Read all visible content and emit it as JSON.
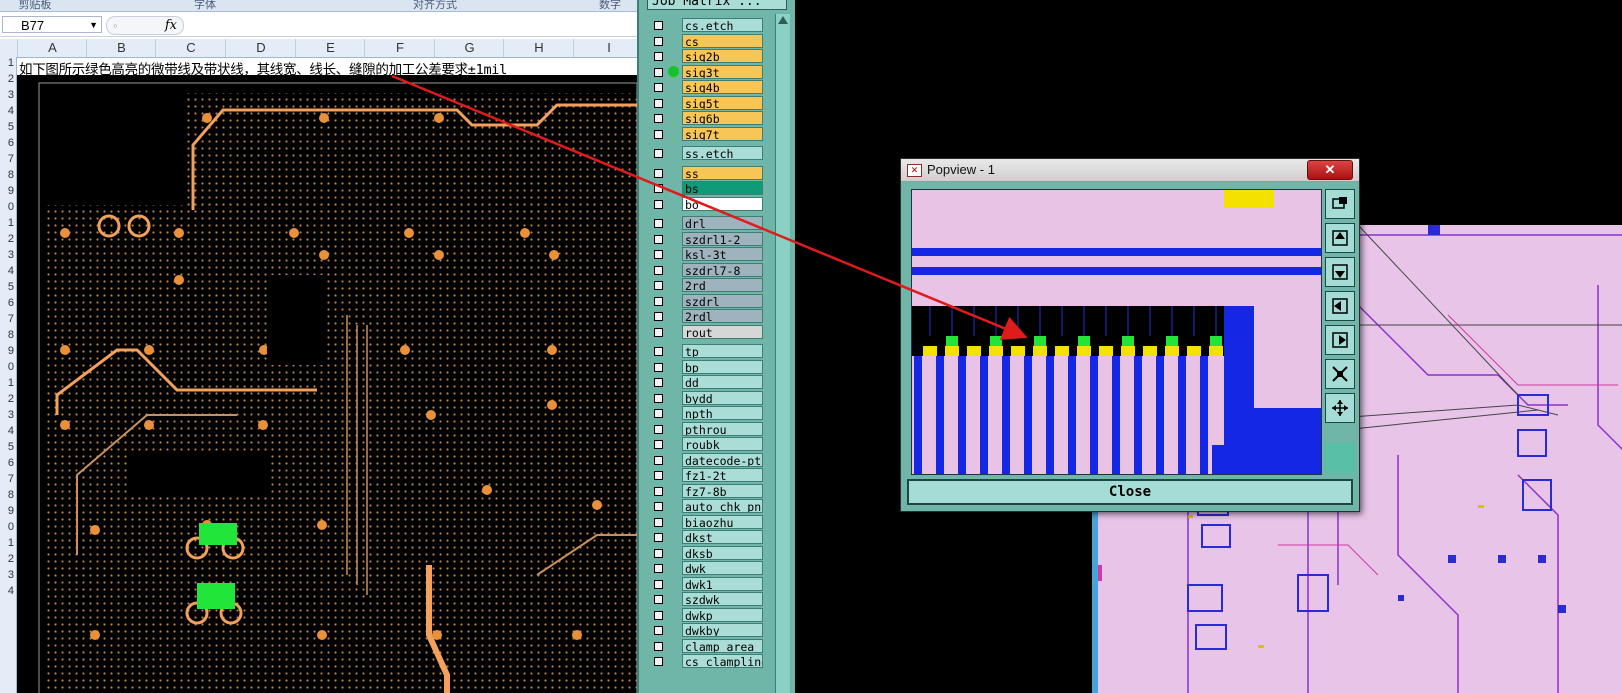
{
  "excel": {
    "ribbon_groups": [
      "剪贴板",
      "字体",
      "对齐方式",
      "数字"
    ],
    "name_box": "B77",
    "fx": "fx",
    "columns": [
      "A",
      "B",
      "C",
      "D",
      "E",
      "F",
      "G",
      "H",
      "I"
    ],
    "rows": [
      "1",
      "2",
      "3",
      "4",
      "5",
      "6",
      "7",
      "8",
      "9",
      "0",
      "1",
      "2",
      "3",
      "4",
      "5",
      "6",
      "7",
      "8",
      "9",
      "0",
      "1",
      "2",
      "3",
      "4",
      "5",
      "6",
      "7",
      "8",
      "9",
      "0",
      "1",
      "2",
      "3",
      "4"
    ],
    "cell_a1": "如下图所示绿色高亮的微带线及带状线，其线宽、线长、缝隙的加工公差要求±1mil"
  },
  "job_matrix": {
    "title": "Job Matrix ...",
    "layers": [
      {
        "name": "cs.etch",
        "color": "#a9ddd6"
      },
      {
        "name": "cs",
        "color": "#f7c656"
      },
      {
        "name": "sig2b",
        "color": "#f7c656"
      },
      {
        "name": "sig3t",
        "color": "#f7c656",
        "active": true
      },
      {
        "name": "sig4b",
        "color": "#f7c656"
      },
      {
        "name": "sig5t",
        "color": "#f7c656"
      },
      {
        "name": "sig6b",
        "color": "#f7c656"
      },
      {
        "name": "sig7t",
        "color": "#f7c656"
      },
      {
        "name": "ss.etch",
        "color": "#a9ddd6"
      },
      {
        "name": "ss",
        "color": "#f7c656"
      },
      {
        "name": "bs",
        "color": "#0f9a78"
      },
      {
        "name": "bo",
        "color": "#ffffff"
      },
      {
        "name": "drl",
        "color": "#9eb3bd"
      },
      {
        "name": "szdrl1-2",
        "color": "#9eb3bd"
      },
      {
        "name": "ksl-3t",
        "color": "#9eb3bd"
      },
      {
        "name": "szdrl7-8",
        "color": "#9eb3bd"
      },
      {
        "name": "2rd",
        "color": "#9eb3bd"
      },
      {
        "name": "szdrl",
        "color": "#9eb3bd"
      },
      {
        "name": "2rdl",
        "color": "#9eb3bd"
      },
      {
        "name": "rout",
        "color": "#d6d6d6"
      },
      {
        "name": "tp",
        "color": "#a9ddd6"
      },
      {
        "name": "bp",
        "color": "#a9ddd6"
      },
      {
        "name": "dd",
        "color": "#a9ddd6"
      },
      {
        "name": "bydd",
        "color": "#a9ddd6"
      },
      {
        "name": "npth",
        "color": "#a9ddd6"
      },
      {
        "name": "pthrou",
        "color": "#a9ddd6"
      },
      {
        "name": "roubk",
        "color": "#a9ddd6"
      },
      {
        "name": "datecode-pt",
        "color": "#a9ddd6"
      },
      {
        "name": "fz1-2t",
        "color": "#a9ddd6"
      },
      {
        "name": "fz7-8b",
        "color": "#a9ddd6"
      },
      {
        "name": "auto_chk_pn",
        "color": "#a9ddd6"
      },
      {
        "name": "biaozhu",
        "color": "#a9ddd6"
      },
      {
        "name": "dkst",
        "color": "#a9ddd6"
      },
      {
        "name": "dksb",
        "color": "#a9ddd6"
      },
      {
        "name": "dwk",
        "color": "#a9ddd6"
      },
      {
        "name": "dwk1",
        "color": "#a9ddd6"
      },
      {
        "name": "szdwk",
        "color": "#a9ddd6"
      },
      {
        "name": "dwkp",
        "color": "#a9ddd6"
      },
      {
        "name": "dwkby",
        "color": "#a9ddd6"
      },
      {
        "name": "clamp_area",
        "color": "#a9ddd6"
      },
      {
        "name": "cs_clampling",
        "color": "#a9ddd6"
      }
    ]
  },
  "popview": {
    "title": "Popview - 1",
    "close_x": "✕",
    "close_label": "Close",
    "tools": [
      "zoom-window-icon",
      "pan-up-icon",
      "pan-down-icon",
      "pan-left-icon",
      "pan-right-icon",
      "zoom-fit-icon",
      "zoom-center-icon"
    ]
  },
  "colors": {
    "annotation_arrow": "#e01b1b",
    "trace": "#f2a15d",
    "highlight": "#22e53a",
    "cad_bg": "#e9c3e6",
    "cad_blue": "#1427e4",
    "cad_yellow": "#f4e100"
  }
}
